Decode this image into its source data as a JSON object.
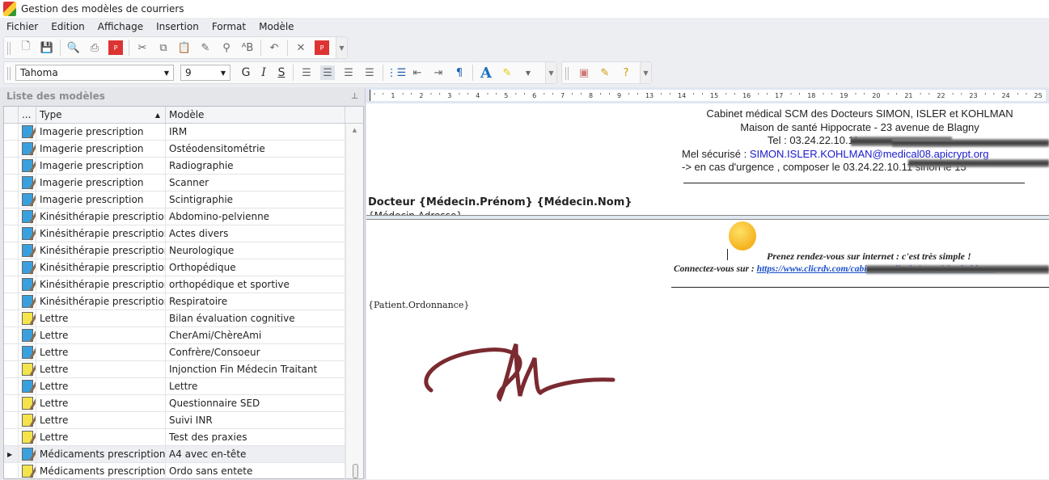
{
  "window": {
    "title": "Gestion des modèles de courriers"
  },
  "menu": [
    "Fichier",
    "Edition",
    "Affichage",
    "Insertion",
    "Format",
    "Modèle"
  ],
  "toolbar1": [
    "new-icon",
    "save-icon",
    "print-preview-icon",
    "print-icon",
    "pdf-icon",
    "cut-icon",
    "copy-icon",
    "paste-icon",
    "eraser-icon",
    "find-icon",
    "replace-icon",
    "undo-icon",
    "delete-icon",
    "export-pdf-icon"
  ],
  "format": {
    "font": "Tahoma",
    "size": "9",
    "bold": "G",
    "italic": "I",
    "strike": "S"
  },
  "panel": {
    "title": "Liste des modèles",
    "col_dots": "...",
    "col_type": "Type",
    "col_model": "Modèle"
  },
  "rows": [
    {
      "type": "Imagerie prescription",
      "model": "IRM",
      "icon": "blue"
    },
    {
      "type": "Imagerie prescription",
      "model": "Ostéodensitométrie",
      "icon": "blue"
    },
    {
      "type": "Imagerie prescription",
      "model": "Radiographie",
      "icon": "blue"
    },
    {
      "type": "Imagerie prescription",
      "model": "Scanner",
      "icon": "blue"
    },
    {
      "type": "Imagerie prescription",
      "model": "Scintigraphie",
      "icon": "blue"
    },
    {
      "type": "Kinésithérapie prescription",
      "model": "Abdomino-pelvienne",
      "icon": "blue"
    },
    {
      "type": "Kinésithérapie prescription",
      "model": "Actes divers",
      "icon": "blue"
    },
    {
      "type": "Kinésithérapie prescription",
      "model": "Neurologique",
      "icon": "blue"
    },
    {
      "type": "Kinésithérapie prescription",
      "model": "Orthopédique",
      "icon": "blue"
    },
    {
      "type": "Kinésithérapie prescription",
      "model": "orthopédique et sportive",
      "icon": "blue"
    },
    {
      "type": "Kinésithérapie prescription",
      "model": "Respiratoire",
      "icon": "blue"
    },
    {
      "type": "Lettre",
      "model": "Bilan évaluation cognitive",
      "icon": "yellow"
    },
    {
      "type": "Lettre",
      "model": "CherAmi/ChèreAmi",
      "icon": "blue"
    },
    {
      "type": "Lettre",
      "model": "Confrère/Consoeur",
      "icon": "blue"
    },
    {
      "type": "Lettre",
      "model": "Injonction Fin Médecin Traitant",
      "icon": "yellow"
    },
    {
      "type": "Lettre",
      "model": "Lettre",
      "icon": "blue"
    },
    {
      "type": "Lettre",
      "model": "Questionnaire SED",
      "icon": "yellow"
    },
    {
      "type": "Lettre",
      "model": "Suivi INR",
      "icon": "yellow"
    },
    {
      "type": "Lettre",
      "model": "Test des praxies",
      "icon": "yellow"
    },
    {
      "type": "Médicaments prescription",
      "model": "A4 avec en-tête",
      "icon": "blue",
      "selected": true
    },
    {
      "type": "Médicaments prescription",
      "model": "Ordo sans entete",
      "icon": "yellow"
    }
  ],
  "ruler": "' ' 1 ' ' 2 ' ' 3 ' ' 4 ' ' 5 ' ' 6 ' ' 7 ' ' 8 ' ' 9 ' ' 13 ' ' 14 ' ' 15 ' ' 16 ' ' 17 ' ' 18 ' ' 19 ' ' 20 ' ' 21 ' ' 22 ' ' 23 ' ' 24 ' ' 25",
  "doc": {
    "line1": "Cabinet médical SCM des Docteurs SIMON, ISLER et KOHLMAN",
    "line2": "Maison de santé Hippocrate  -  23 avenue de Blagny",
    "tel": "Tel : 03.24.22.10.11",
    "mel_label": "Mel sécurisé : ",
    "mel": "SIMON.ISLER.KOHLMAN@medical08.apicrypt.org",
    "urgence": "-> en cas d'urgence , composer le 03.24.22.10.11 sinon le 15",
    "doctor": "Docteur {Médecin.Prénom} {Médecin.Nom}",
    "address": "{Médecin.Adresse}",
    "rdv": "Prenez rendez-vous sur internet : c'est très simple !",
    "connect": "Connectez-vous sur : ",
    "link": "https://www.clicrdv.com/cabinet-medical-simon-isler-kohlman",
    "patient": "{Patient.Ordonnance}"
  },
  "colors": {
    "signature": "#7a2a30",
    "link": "#1a4fc9",
    "mel": "#1a1acc"
  }
}
